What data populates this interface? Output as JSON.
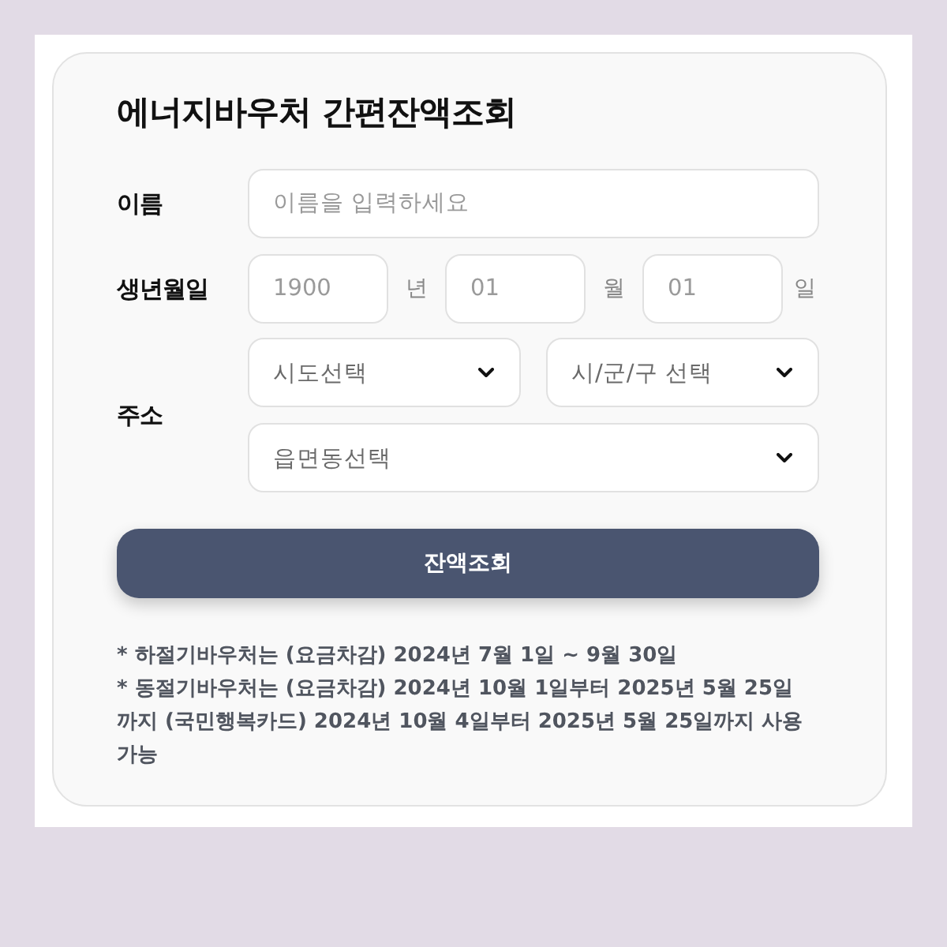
{
  "title": "에너지바우처 간편잔액조회",
  "name_row": {
    "label": "이름",
    "placeholder": "이름을 입력하세요"
  },
  "birth_row": {
    "label": "생년월일",
    "fields": [
      {
        "placeholder": "1900",
        "unit": "년"
      },
      {
        "placeholder": "01",
        "unit": "월"
      },
      {
        "placeholder": "01",
        "unit": "일"
      }
    ]
  },
  "address_row": {
    "label": "주소",
    "selects": [
      {
        "placeholder": "시도선택"
      },
      {
        "placeholder": "시/군/구 선택"
      },
      {
        "placeholder": "읍면동선택"
      }
    ]
  },
  "submit_button": "잔액조회",
  "notes": [
    "* 하절기바우처는 (요금차감) 2024년 7월 1일 ~ 9월 30일",
    "* 동절기바우처는 (요금차감) 2024년 10월 1일부터 2025년 5월 25일까지 (국민행복카드) 2024년 10월 4일부터 2025년 5월 25일까지 사용가능"
  ]
}
